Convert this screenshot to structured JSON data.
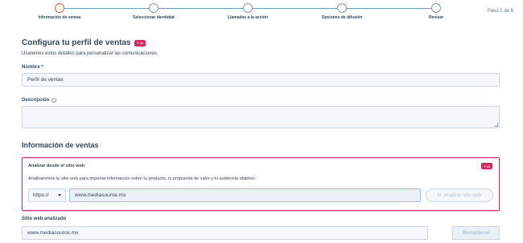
{
  "stepper": {
    "steps": [
      {
        "label": "Información de ventas"
      },
      {
        "label": "Seleccionar identidad"
      },
      {
        "label": "Llamadas a la acción"
      },
      {
        "label": "Opciones de difusión"
      },
      {
        "label": "Revisar"
      }
    ],
    "active_step": 1,
    "counter": "Paso 1 de 5"
  },
  "profile": {
    "title": "Configura tu perfil de ventas",
    "ai_badge": "AI",
    "subtitle": "Usaremos estos detalles para personalizar las comunicaciones.",
    "name_label": "Nombre *",
    "name_value": "Perfil de ventas",
    "description_label": "Descripción",
    "description_value": ""
  },
  "sales_info": {
    "title": "Información de ventas",
    "analyze": {
      "title": "Analizar desde el sitio web",
      "ai_badge": "AI",
      "description": "Analizaremos tu sitio web para importar información sobre tu producto, tu propuesta de valor y tu audiencia objetivo.",
      "protocol": "https://",
      "url_value": "www.mediasource.mx",
      "button_label": "Analizar sitio web"
    },
    "analyzed_label": "Sitio web analizado",
    "analyzed_value": "www.mediasource.mx",
    "reset_label": "Restablecer"
  },
  "colors": {
    "accent": "#ff5c35",
    "ai": "#e5215b",
    "text": "#33475b"
  }
}
